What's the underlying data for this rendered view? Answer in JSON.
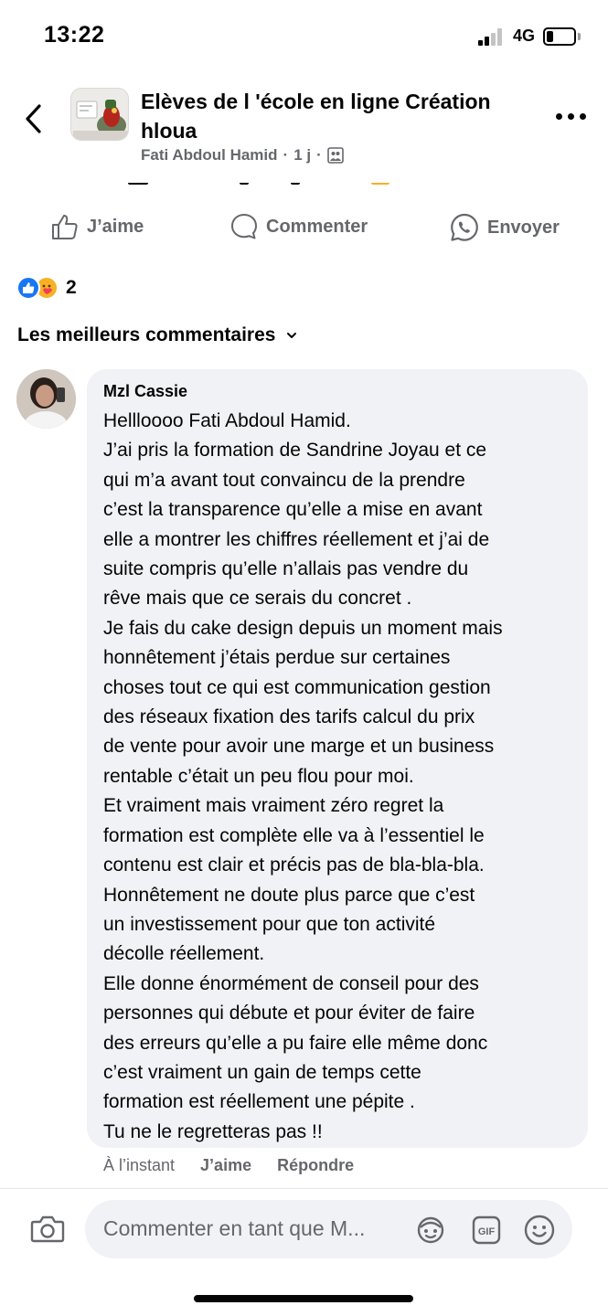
{
  "status_bar": {
    "time": "13:22",
    "network": "4G",
    "battery_level": 0.2,
    "signal_bars": 2
  },
  "header": {
    "group_name": "Elèves de l 'école en ligne Création hloua",
    "author": "Fati Abdoul Hamid",
    "separator": "·",
    "age": "1 j",
    "audience_icon": "group-audience-icon"
  },
  "actions": {
    "like": "J’aime",
    "comment": "Commenter",
    "send": "Envoyer"
  },
  "reactions": {
    "types": [
      "like",
      "care"
    ],
    "count": "2",
    "colors": {
      "like": "#1877f2",
      "care": "#f7b125"
    }
  },
  "comments_section": {
    "sort_label": "Les meilleurs commentaires"
  },
  "comment": {
    "author": "Mzl Cassie",
    "lines": [
      "Hellloooo Fati Abdoul Hamid.",
      "J’ai pris la formation de Sandrine Joyau et ce",
      "qui m’a avant tout convaincu de la prendre",
      "c’est la transparence qu’elle a mise en avant",
      "elle a montrer les chiffres réellement et j’ai de",
      "suite compris qu’elle n’allais pas vendre du",
      "rêve mais que ce serais du concret .",
      "Je fais du cake design depuis un moment mais",
      "honnêtement j’étais perdue sur certaines",
      "choses tout ce qui est communication gestion",
      "des réseaux fixation des tarifs calcul du prix",
      "de vente pour avoir une marge et un business",
      "rentable c’était un peu flou pour moi.",
      "Et vraiment mais vraiment zéro regret la",
      "formation est complète elle va à l’essentiel le",
      "contenu est clair et précis pas de bla-bla-bla.",
      "Honnêtement ne doute plus parce que c’est",
      "un investissement pour que ton activité",
      "décolle réellement.",
      "Elle donne énormément de conseil pour des",
      "personnes qui débute et pour éviter de faire",
      "des erreurs qu’elle a pu faire elle même donc",
      "c’est vraiment un gain de temps cette",
      "formation est réellement une pépite .",
      "Tu ne le regretteras pas !!"
    ],
    "time": "À l’instant",
    "like": "J’aime",
    "reply": "Répondre"
  },
  "composer": {
    "placeholder": "Commenter en tant que M...",
    "gif_label": "GIF"
  },
  "colors": {
    "accent": "#1877f2",
    "secondary_text": "#65676b",
    "bubble": "#f0f2f5"
  }
}
